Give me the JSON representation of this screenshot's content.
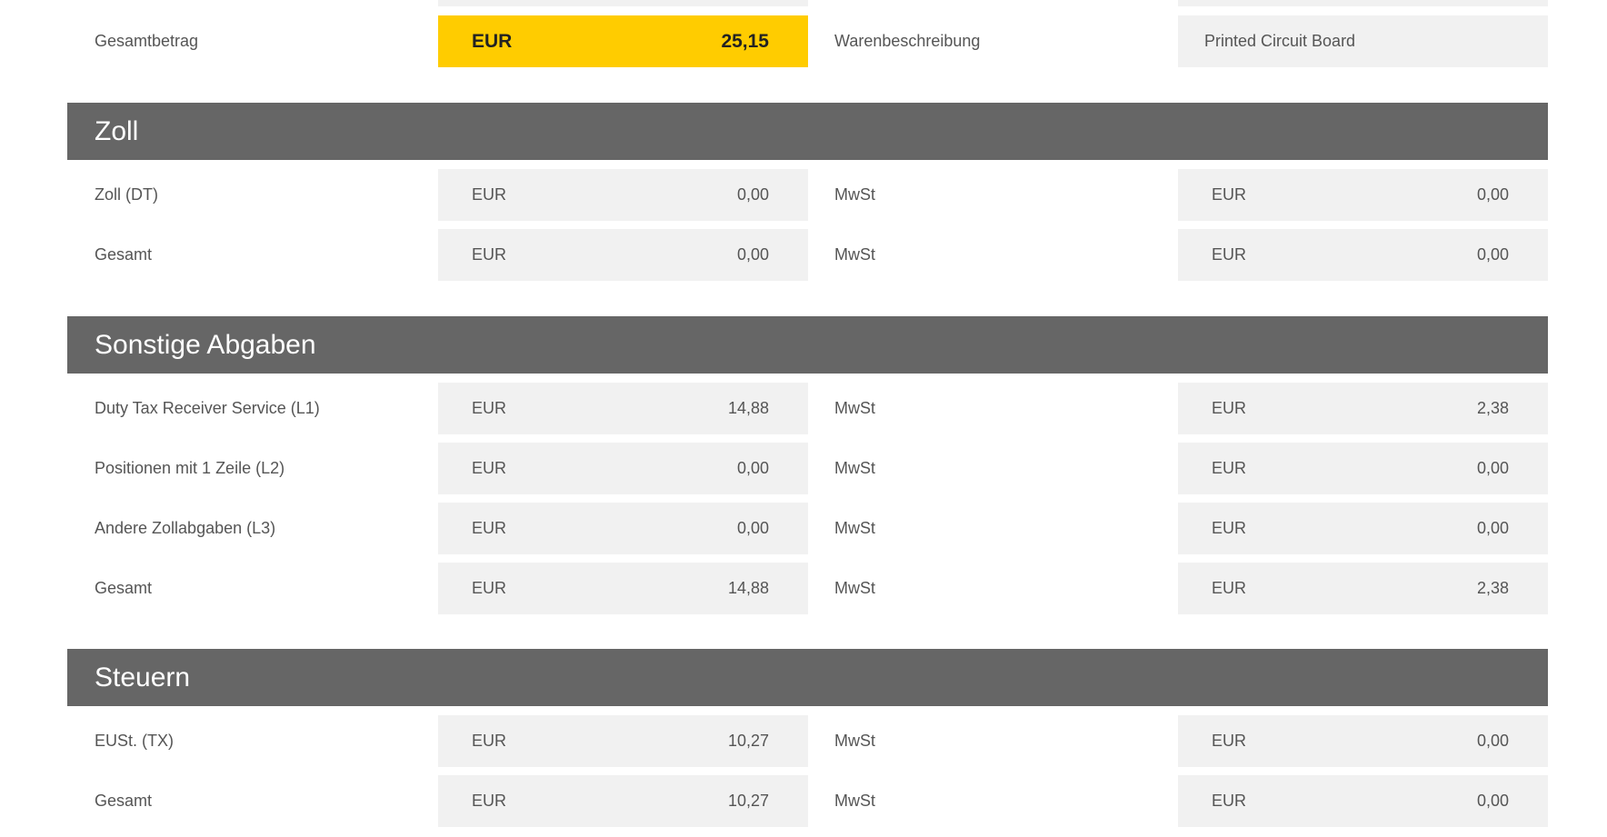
{
  "summary": {
    "total_label": "Gesamtbetrag",
    "total_currency": "EUR",
    "total_amount": "25,15",
    "description_label": "Warenbeschreibung",
    "description_value": "Printed Circuit Board"
  },
  "sections": {
    "zoll": {
      "title": "Zoll",
      "rows": [
        {
          "label": "Zoll (DT)",
          "currency": "EUR",
          "amount": "0,00",
          "vat_label": "MwSt",
          "vat_currency": "EUR",
          "vat_amount": "0,00"
        },
        {
          "label": "Gesamt",
          "currency": "EUR",
          "amount": "0,00",
          "vat_label": "MwSt",
          "vat_currency": "EUR",
          "vat_amount": "0,00"
        }
      ]
    },
    "sonstige": {
      "title": "Sonstige Abgaben",
      "rows": [
        {
          "label": "Duty Tax Receiver Service (L1)",
          "currency": "EUR",
          "amount": "14,88",
          "vat_label": "MwSt",
          "vat_currency": "EUR",
          "vat_amount": "2,38"
        },
        {
          "label": "Positionen mit 1 Zeile (L2)",
          "currency": "EUR",
          "amount": "0,00",
          "vat_label": "MwSt",
          "vat_currency": "EUR",
          "vat_amount": "0,00"
        },
        {
          "label": "Andere Zollabgaben (L3)",
          "currency": "EUR",
          "amount": "0,00",
          "vat_label": "MwSt",
          "vat_currency": "EUR",
          "vat_amount": "0,00"
        },
        {
          "label": "Gesamt",
          "currency": "EUR",
          "amount": "14,88",
          "vat_label": "MwSt",
          "vat_currency": "EUR",
          "vat_amount": "2,38"
        }
      ]
    },
    "steuern": {
      "title": "Steuern",
      "rows": [
        {
          "label": "EUSt. (TX)",
          "currency": "EUR",
          "amount": "10,27",
          "vat_label": "MwSt",
          "vat_currency": "EUR",
          "vat_amount": "0,00"
        },
        {
          "label": "Gesamt",
          "currency": "EUR",
          "amount": "10,27",
          "vat_label": "MwSt",
          "vat_currency": "EUR",
          "vat_amount": "0,00"
        }
      ]
    }
  },
  "colors": {
    "header_bg": "#666666",
    "field_bg": "#f1f1f1",
    "highlight_bg": "#ffcc00"
  }
}
